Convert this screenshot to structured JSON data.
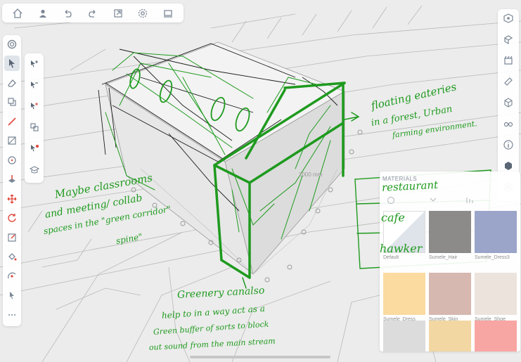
{
  "annotations": {
    "floating_1": "floating eateries",
    "floating_2": "in a forest, Urban",
    "floating_3": "farming environment.",
    "maybe_1": "Maybe classrooms",
    "maybe_2": "and meeting/ collab",
    "maybe_3": "spaces in the \"green corridor\"",
    "maybe_4": "spine\"",
    "greenery_1": "Greenery canalso",
    "greenery_2": "help to in a way act as a",
    "greenery_3": "Green buffer of sorts to block",
    "greenery_4": "out sound from the main stream",
    "restaurant": "restaurant",
    "cafe": "cafe",
    "hawker": "hawker"
  },
  "materials": {
    "header": "MATERIALS",
    "swatches": [
      {
        "label": "Default",
        "color": "#ffffff"
      },
      {
        "label": "Sumele_Hair",
        "color": "#8c8b89"
      },
      {
        "label": "Sumele_Dress3",
        "color": "#9ba5c9"
      },
      {
        "label": "Sumele_Dress",
        "color": "#fbdba0"
      },
      {
        "label": "Sumele_Skin",
        "color": "#d6b8b1"
      },
      {
        "label": "Sumele_Shoe",
        "color": "#ece3dd"
      },
      {
        "label": "",
        "color": "#dcdcdc"
      },
      {
        "label": "",
        "color": "#f2d7a3"
      },
      {
        "label": "",
        "color": "#f8a6a3"
      }
    ]
  },
  "canvas_label": "2000 mm",
  "colors": {
    "sketch_green": "#1e9a1e",
    "toolbar_bg": "#ffffff",
    "accent_red": "#e0453a",
    "icon_gray": "#7b8796"
  }
}
